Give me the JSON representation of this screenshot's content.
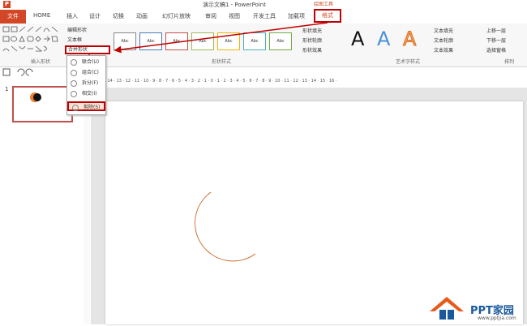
{
  "window": {
    "title": "演示文稿1 - PowerPoint",
    "context_tab_group": "绘图工具"
  },
  "tabs": [
    {
      "id": "file",
      "label": "文件"
    },
    {
      "id": "home",
      "label": "HOME"
    },
    {
      "id": "insert",
      "label": "插入"
    },
    {
      "id": "design",
      "label": "设计"
    },
    {
      "id": "transitions",
      "label": "切换"
    },
    {
      "id": "animations",
      "label": "动画"
    },
    {
      "id": "slideshow",
      "label": "幻灯片放映"
    },
    {
      "id": "review",
      "label": "审阅"
    },
    {
      "id": "view",
      "label": "视图"
    },
    {
      "id": "developer",
      "label": "开发工具"
    },
    {
      "id": "addins",
      "label": "加载项"
    },
    {
      "id": "format",
      "label": "格式"
    }
  ],
  "ribbon": {
    "insert_shapes": {
      "group_label": "插入形状",
      "edit_shape": "编辑形状",
      "text_box": "文本框",
      "merge_shapes": "合并形状"
    },
    "shape_styles": {
      "group_label": "形状样式",
      "preset_label": "Abc",
      "fill": "形状填充",
      "outline": "形状轮廓",
      "effects": "形状效果"
    },
    "wordart": {
      "group_label": "艺术字样式",
      "letter": "A",
      "text_fill": "文本填充",
      "text_outline": "文本轮廓",
      "text_effects": "文本效果"
    },
    "arrange": {
      "group_label": "排列",
      "bring_forward": "上移一层",
      "send_backward": "下移一层",
      "selection_pane": "选择窗格"
    }
  },
  "merge_menu": {
    "items": [
      {
        "label": "联合(U)"
      },
      {
        "label": "组合(C)"
      },
      {
        "label": "拆分(F)"
      },
      {
        "label": "相交(I)"
      },
      {
        "label": "剪除(S)"
      }
    ]
  },
  "ruler_labels": "· 16 · 15 · 14 · 13 · 12 · 11 · 10 · 9 · 8 · 7 · 6 · 5 · 4 · 3 · 2 · 1 · 0 · 1 · 2 · 3 · 4 · 5 · 6 · 7 · 8 · 9 · 10 · 11 · 12 · 13 · 14 · 15 · 16 ·",
  "thumbnail": {
    "number": "1"
  },
  "colors": {
    "accent": "#d24726",
    "highlight": "#c00000",
    "moon": "#ed7d31"
  },
  "watermark": {
    "text": "PPT家园",
    "url": "www.pptjia.com"
  }
}
